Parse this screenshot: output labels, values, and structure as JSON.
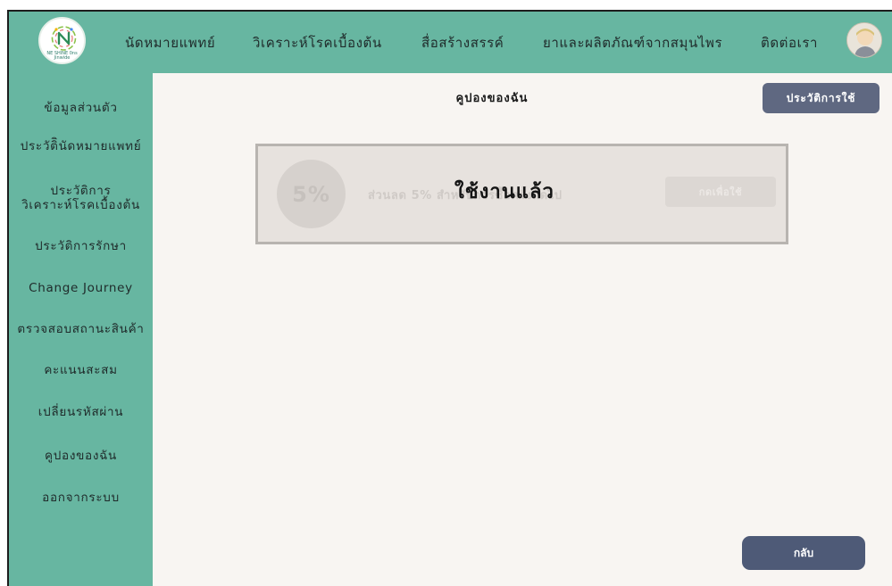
{
  "header": {
    "logo_text": "NE SHINE 0ns Jinwide",
    "nav": [
      {
        "label": "นัดหมายแพทย์"
      },
      {
        "label": "วิเคราะห์โรคเบื้องต้น"
      },
      {
        "label": "สื่อสร้างสรรค์"
      },
      {
        "label": "ยาและผลิตภัณฑ์จากสมุนไพร"
      },
      {
        "label": "ติดต่อเรา"
      }
    ]
  },
  "sidebar": {
    "items": [
      {
        "label": "ข้อมูลส่วนตัว"
      },
      {
        "label": "ประวัติินัดหมายแพทย์"
      },
      {
        "label": "ประวัติการ",
        "label2": "วิเคราะห์โรคเบื้องต้น"
      },
      {
        "label": "ประวัติการรักษา"
      },
      {
        "label": "Change Journey"
      },
      {
        "label": "ตรวจสอบสถานะสินค้า"
      },
      {
        "label": "คะแนนสะสม"
      },
      {
        "label": "เปลี่ยนรหัสผ่าน"
      },
      {
        "label": "คูปองของฉัน"
      },
      {
        "label": "ออกจากระบบ"
      }
    ]
  },
  "main": {
    "title": "คูปองของฉัน",
    "history_button": "ประวัติการใช้",
    "coupon": {
      "percent": "5%",
      "description": "ส่วนลด 5% สำหรับการซื้อครั้งถัดไป",
      "use_button": "กดเพื่อใช้",
      "status_overlay": "ใช้งานแล้ว"
    },
    "back_button": "กลับ"
  },
  "colors": {
    "header_bg": "#67b6a1",
    "sidebar_bg": "#67b6a1",
    "main_bg": "#f8f5f2",
    "button_bg": "#5f6881",
    "back_button_bg": "#4e5a77"
  }
}
